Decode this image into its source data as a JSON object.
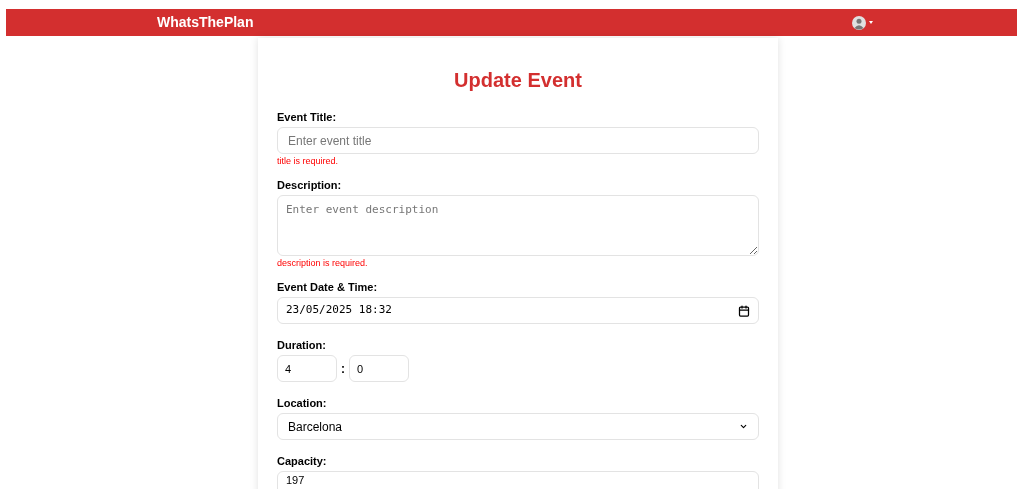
{
  "navbar": {
    "brand": "WhatsThePlan"
  },
  "form": {
    "title": "Update Event",
    "fields": [
      {
        "kind": "text",
        "label": "Event Title:",
        "placeholder": "Enter event title",
        "error": "title is required."
      },
      {
        "kind": "textarea",
        "label": "Description:",
        "placeholder": "Enter event description",
        "error": "description is required."
      },
      {
        "kind": "datetime",
        "label": "Event Date & Time:",
        "value": "23/05/2025 18:32"
      },
      {
        "kind": "duration",
        "label": "Duration:",
        "hours": "4",
        "separator": ":",
        "minutes": "0"
      },
      {
        "kind": "select",
        "label": "Location:",
        "value": "Barcelona"
      },
      {
        "kind": "number",
        "label": "Capacity:",
        "value": "197"
      }
    ]
  }
}
